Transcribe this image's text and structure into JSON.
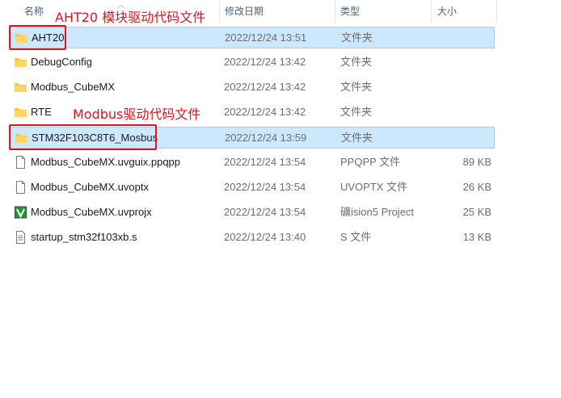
{
  "columns": {
    "name": "名称",
    "modified": "修改日期",
    "type": "类型",
    "size": "大小"
  },
  "annotations": {
    "aht20_note": "AHT20 模块驱动代码文件",
    "modbus_note": "Modbus驱动代码文件"
  },
  "colors": {
    "annotation": "#e0141e",
    "selection_bg": "#cce8ff",
    "selection_border": "#99d1ff",
    "folder": "#f8c64b"
  },
  "files": [
    {
      "name": "AHT20",
      "date": "2022/12/24 13:51",
      "type": "文件夹",
      "size": "",
      "icon": "folder-icon",
      "selected": true
    },
    {
      "name": "DebugConfig",
      "date": "2022/12/24 13:42",
      "type": "文件夹",
      "size": "",
      "icon": "folder-icon",
      "selected": false
    },
    {
      "name": "Modbus_CubeMX",
      "date": "2022/12/24 13:42",
      "type": "文件夹",
      "size": "",
      "icon": "folder-icon",
      "selected": false
    },
    {
      "name": "RTE",
      "date": "2022/12/24 13:42",
      "type": "文件夹",
      "size": "",
      "icon": "folder-icon",
      "selected": false
    },
    {
      "name": "STM32F103C8T6_Mosbus",
      "date": "2022/12/24 13:59",
      "type": "文件夹",
      "size": "",
      "icon": "folder-icon",
      "selected": true
    },
    {
      "name": "Modbus_CubeMX.uvguix.ppqpp",
      "date": "2022/12/24 13:54",
      "type": "PPQPP 文件",
      "size": "89 KB",
      "icon": "file-icon",
      "selected": false
    },
    {
      "name": "Modbus_CubeMX.uvoptx",
      "date": "2022/12/24 13:54",
      "type": "UVOPTX 文件",
      "size": "26 KB",
      "icon": "file-icon",
      "selected": false
    },
    {
      "name": "Modbus_CubeMX.uvprojx",
      "date": "2022/12/24 13:54",
      "type": "礦ision5 Project",
      "size": "25 KB",
      "icon": "keil-project-icon",
      "selected": false
    },
    {
      "name": "startup_stm32f103xb.s",
      "date": "2022/12/24 13:40",
      "type": "S 文件",
      "size": "13 KB",
      "icon": "text-file-icon",
      "selected": false
    }
  ]
}
